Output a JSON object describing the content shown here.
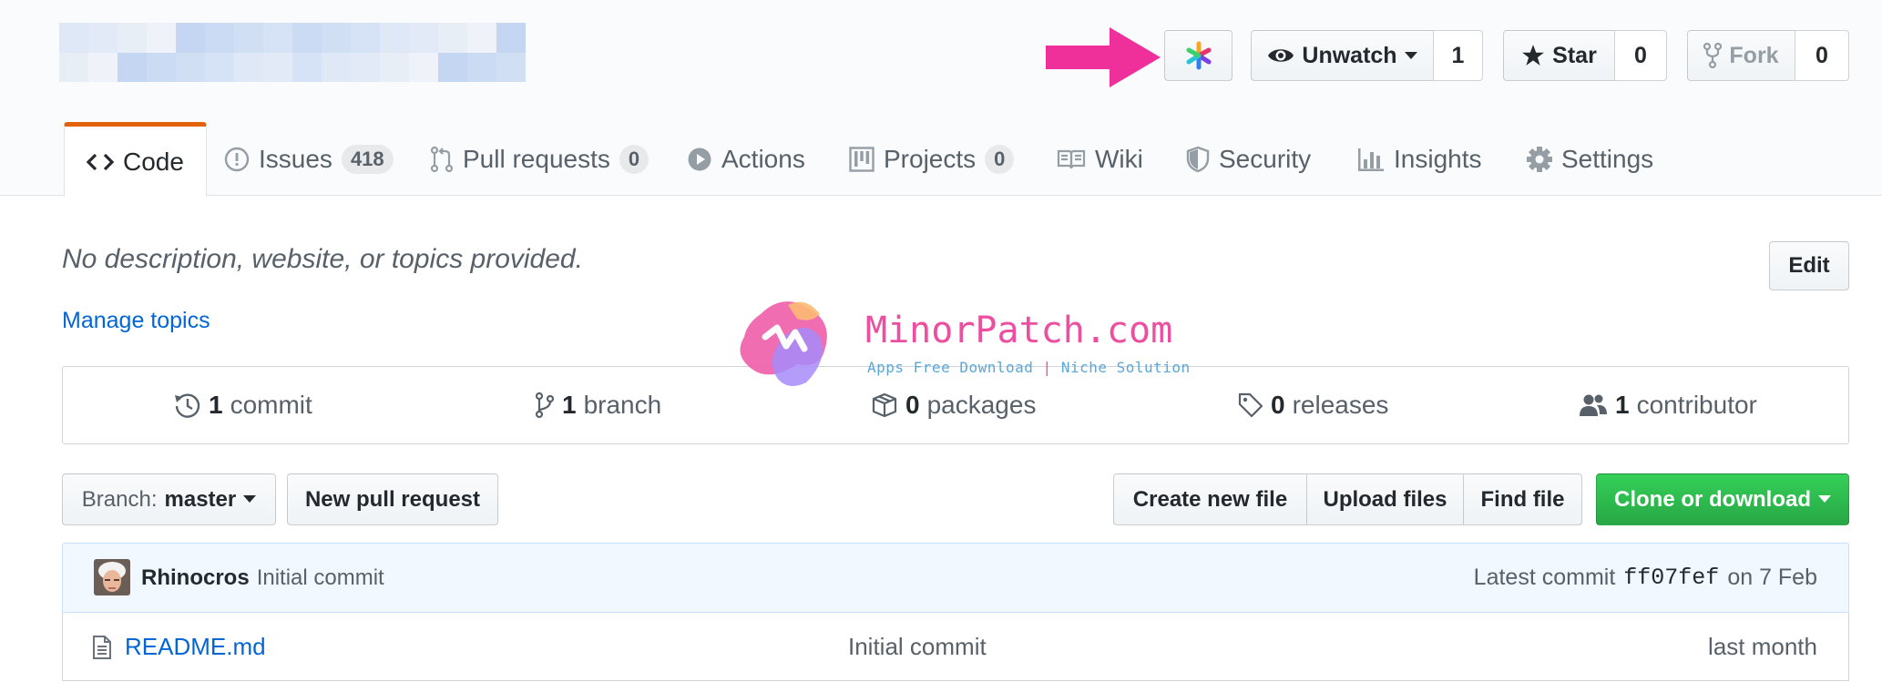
{
  "colors": {
    "accent_tab": "#e36209",
    "link": "#0366d6",
    "clone_green": "#28a745",
    "arrow_pink": "#ef2f9a",
    "watermark_pink": "#ec4f9f",
    "watermark_blue": "#5aa7d8"
  },
  "header": {
    "repo_name_blurred": true,
    "extension_icon": "octolinker-asterisk-icon",
    "watch": {
      "label": "Unwatch",
      "count": "1"
    },
    "star": {
      "label": "Star",
      "count": "0"
    },
    "fork": {
      "label": "Fork",
      "count": "0"
    }
  },
  "tabs": [
    {
      "label": "Code",
      "icon": "code-icon",
      "selected": true
    },
    {
      "label": "Issues",
      "icon": "issue-opened-icon",
      "counter": "418"
    },
    {
      "label": "Pull requests",
      "icon": "git-pull-request-icon",
      "counter": "0"
    },
    {
      "label": "Actions",
      "icon": "play-icon"
    },
    {
      "label": "Projects",
      "icon": "project-icon",
      "counter": "0"
    },
    {
      "label": "Wiki",
      "icon": "book-icon"
    },
    {
      "label": "Security",
      "icon": "shield-icon"
    },
    {
      "label": "Insights",
      "icon": "graph-icon"
    },
    {
      "label": "Settings",
      "icon": "gear-icon"
    }
  ],
  "description": {
    "text": "No description, website, or topics provided.",
    "manage_topics": "Manage topics",
    "edit_label": "Edit"
  },
  "summary": {
    "commits": {
      "count": "1",
      "label": "commit"
    },
    "branches": {
      "count": "1",
      "label": "branch"
    },
    "packages": {
      "count": "0",
      "label": "packages"
    },
    "releases": {
      "count": "0",
      "label": "releases"
    },
    "contributors": {
      "count": "1",
      "label": "contributor"
    }
  },
  "file_nav": {
    "branch_prefix": "Branch:",
    "branch_name": "master",
    "new_pull_request": "New pull request",
    "create_new_file": "Create new file",
    "upload_files": "Upload files",
    "find_file": "Find file",
    "clone_or_download": "Clone or download"
  },
  "commit_tease": {
    "author": "Rhinocros",
    "message": "Initial commit",
    "latest_prefix": "Latest commit",
    "sha": "ff07fef",
    "date": "on 7 Feb"
  },
  "files": [
    {
      "name": "README.md",
      "message": "Initial commit",
      "age": "last month"
    }
  ],
  "watermark": {
    "title": "MinorPatch.com",
    "subtitle_left": "Apps Free Download",
    "subtitle_sep": "|",
    "subtitle_right": "Niche Solution"
  }
}
